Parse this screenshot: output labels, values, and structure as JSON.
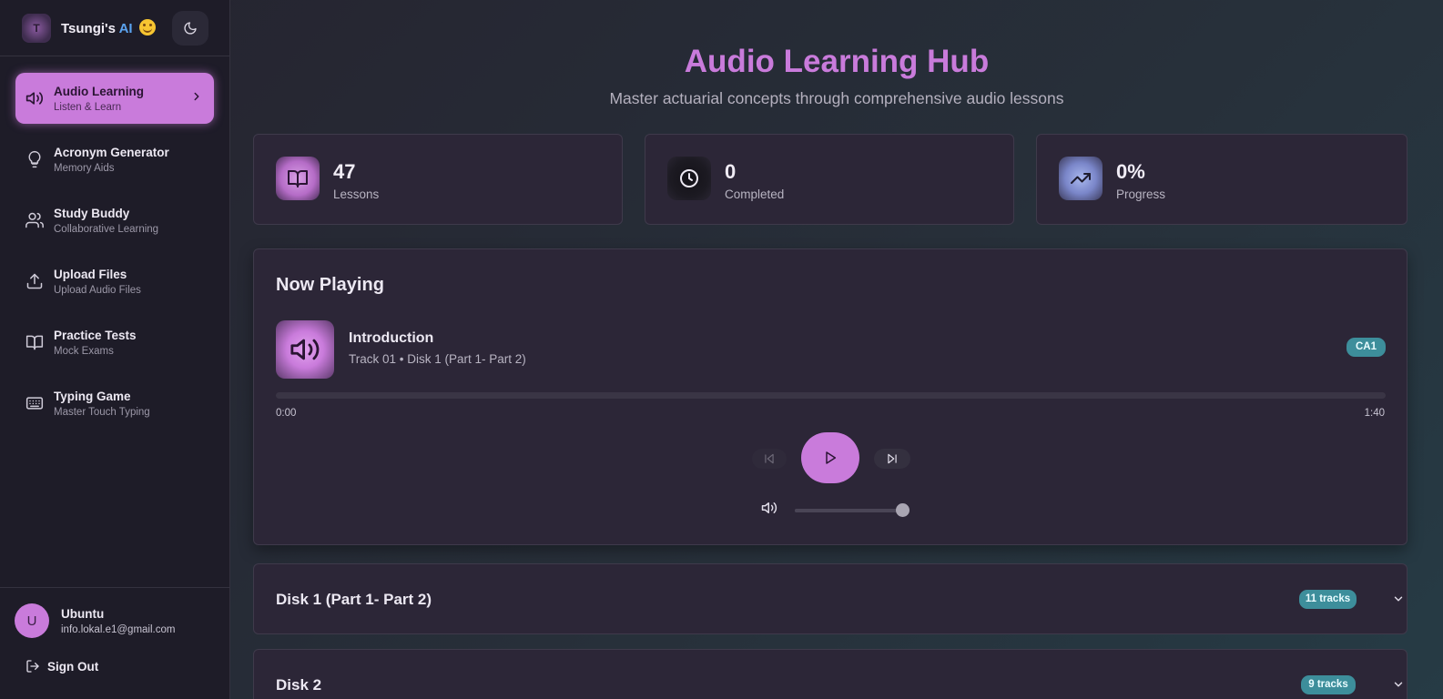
{
  "brand": {
    "logo_letter": "T",
    "name": "Tsungi's",
    "ai": "AI"
  },
  "sidebar": {
    "items": [
      {
        "label": "Audio Learning",
        "sub": "Listen & Learn",
        "icon": "speaker-icon",
        "active": true
      },
      {
        "label": "Acronym Generator",
        "sub": "Memory Aids",
        "icon": "lightbulb-icon"
      },
      {
        "label": "Study Buddy",
        "sub": "Collaborative Learning",
        "icon": "users-icon"
      },
      {
        "label": "Upload Files",
        "sub": "Upload Audio Files",
        "icon": "upload-icon"
      },
      {
        "label": "Practice Tests",
        "sub": "Mock Exams",
        "icon": "book-icon"
      },
      {
        "label": "Typing Game",
        "sub": "Master Touch Typing",
        "icon": "keyboard-icon"
      }
    ],
    "user": {
      "initial": "U",
      "name": "Ubuntu",
      "email": "info.lokal.e1@gmail.com"
    },
    "sign_out": "Sign Out"
  },
  "hero": {
    "title": "Audio Learning Hub",
    "subtitle": "Master actuarial concepts through comprehensive audio lessons"
  },
  "stats": [
    {
      "value": "47",
      "label": "Lessons",
      "icon": "book-open-icon"
    },
    {
      "value": "0",
      "label": "Completed",
      "icon": "clock-icon"
    },
    {
      "value": "0%",
      "label": "Progress",
      "icon": "trending-up-icon"
    }
  ],
  "player": {
    "heading": "Now Playing",
    "track_title": "Introduction",
    "track_meta": "Track 01 • Disk 1 (Part 1- Part 2)",
    "badge": "CA1",
    "current_time": "0:00",
    "duration": "1:40",
    "progress_fraction": 0.0,
    "volume_fraction": 1.0
  },
  "disks": [
    {
      "title": "Disk 1 (Part 1- Part 2)",
      "tracks": "11 tracks"
    },
    {
      "title": "Disk 2",
      "tracks": "9 tracks"
    }
  ],
  "colors": {
    "accent": "#c97bdb",
    "teal_badge": "#3d8e9b",
    "sidebar_bg": "#1e1c28",
    "card_bg": "#2c2637"
  }
}
